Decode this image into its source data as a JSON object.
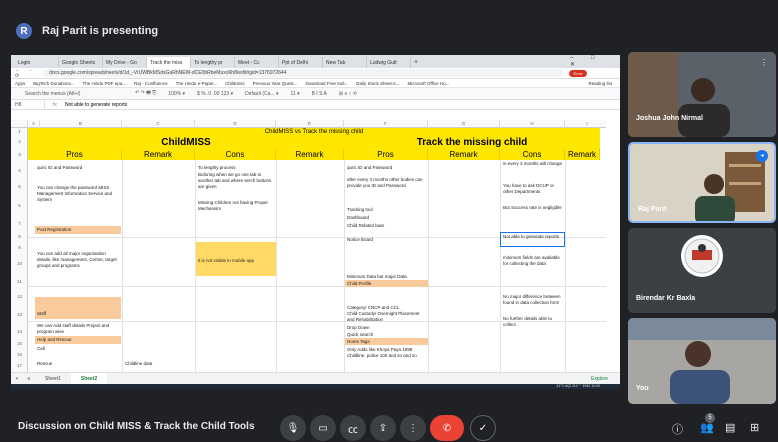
{
  "presenter": {
    "initial": "R",
    "label": "Raj Parit is presenting"
  },
  "browser": {
    "tabs": [
      "Login",
      "Google Sheets",
      "My Drive - Go",
      "Track the miss",
      "To lengthy pr",
      "Meet - Cc",
      "Ppt of Delhi",
      "New Tab",
      "Ludwig Gutt"
    ],
    "active_tab": 3,
    "new_tab": "+",
    "window_controls": "– □ ✕",
    "nav": "← → ⟳",
    "url": "docs.google.com/spreadsheets/d/1d_-VrUWBkMSdsGaRhNEW-dCE0bRbeMuxo6h8/edit#gid=1376972644",
    "profile": "Error",
    "bookmarks": [
      "Apps",
      "BigTech Donations...",
      "The Hindu PDF epa...",
      "Raj - Confluence",
      "The Hindu e-Paper...",
      "Childmiss",
      "Previous Year Quest...",
      "Download Free Indi...",
      "Daily Stock Sheet-2...",
      "Microsoft Office Ho..."
    ],
    "reading_list": "Reading list"
  },
  "sheet": {
    "search": "Search the menus (Alt+/)",
    "toolbar": [
      "↶  ↷  🖶  ⎘",
      "100% ▾",
      "$  %  .0  .00  123 ▾",
      "Default (Ca... ▾",
      "11 ▾",
      "B  I  S  A",
      "⊞  ≡  ↕  ⟲"
    ],
    "cellref": "H8",
    "formula": "Not able to generate reports",
    "col_letters": [
      "A",
      "B",
      "C",
      "D",
      "E",
      "F",
      "G",
      "H",
      "I"
    ],
    "row_numbers": [
      "1",
      "2",
      "3",
      "4",
      "5",
      "6",
      "7",
      "8",
      "9",
      "10",
      "11",
      "12",
      "13",
      "14",
      "15",
      "16",
      "17"
    ],
    "title_row": "ChildMISS vs Track the missing child",
    "section_left": "ChildMISS",
    "section_right": "Track the missing child",
    "col_headers": [
      "Pros",
      "Remark",
      "Cons",
      "Remark",
      "Pros",
      "Remark",
      "Cons",
      "Remark"
    ],
    "cells": {
      "b4": "quric ID and Password",
      "b6": "You can change the password MISS Management Information Service and System",
      "b8": "Post Registration",
      "b10": "You can add all major organisation details, like management, Centre, target groups and programs",
      "b13": "Staff",
      "b14": "We can Add staff details Project and program wise",
      "b15": "Help and Rescue",
      "b16": "Call",
      "b17": "Rescue",
      "c17": "Childline data",
      "d4": "To lengthy process",
      "d5": "Bufuring when we go one tab to another tab and where serch buttons are given",
      "d7": "Missing Children not having Proper Mechanism",
      "d11": "it is not visible in mobile app",
      "f4": "quric ID and Password",
      "f5": "after every 3 months other bodies can provide you ID and Password",
      "f7": "Tracking tool",
      "f8": "Dashboard",
      "f9": "Child Related laws",
      "f10": "Notice Board",
      "f11": "Minimum Data but major Data",
      "f12": "Child Profile",
      "f13": "Category/ CNCP and CCL",
      "f14": "Child Custody/ Overnight Placement  and Rehabilitation",
      "f15": "Drop Down",
      "f16": "Quick search",
      "f17": "Home Tags",
      "f18": "Only Adds like Khoya Paya 1098 Childline, police 100 and so and so",
      "h3": "in every 3 months will change",
      "h5": "You have to ask DCUP or other Departments",
      "h7": "But Success rate is negligible",
      "h8": "Not able to generate reports",
      "h10": "minimum fields are available for collecting the data",
      "h13": "No major difference between found in data collection form",
      "h14": "No further details able to collect"
    },
    "sheet_tabs": [
      "Sheet1",
      "Sheet2"
    ],
    "active_sheet": 1,
    "explore": "Explore",
    "taskbar_status": "31°C  AQI 212  ⌃  ENG  10:09"
  },
  "participants": [
    {
      "name": "Joshua John Nirmal"
    },
    {
      "name": "Raj Parit"
    },
    {
      "name": "Birendar Kr Baxla"
    },
    {
      "name": "You"
    }
  ],
  "meeting": {
    "title": "Discussion on Child MISS & Track the Child Tools",
    "people_count": "5"
  },
  "colors": {
    "yellow": "#ffe600",
    "peach": "#f9cb9c",
    "light_yellow": "#fff2cc",
    "end_call": "#ea4335",
    "green": "#188038"
  }
}
